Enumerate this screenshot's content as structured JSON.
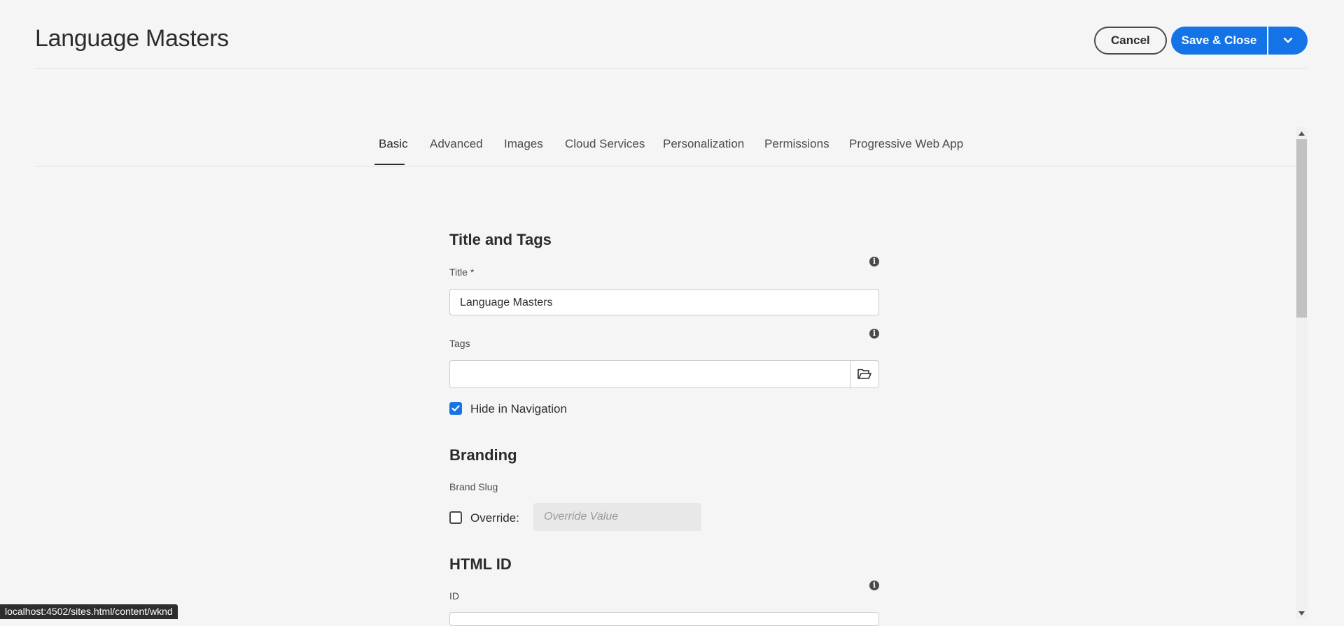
{
  "header": {
    "title": "Language Masters",
    "cancel_label": "Cancel",
    "save_label": "Save & Close"
  },
  "tabs": [
    {
      "label": "Basic",
      "active": true
    },
    {
      "label": "Advanced"
    },
    {
      "label": "Images"
    },
    {
      "label": "Cloud Services"
    },
    {
      "label": "Personalization"
    },
    {
      "label": "Permissions"
    },
    {
      "label": "Progressive Web App"
    }
  ],
  "form": {
    "title_and_tags": {
      "heading": "Title and Tags",
      "title_label": "Title *",
      "title_value": "Language Masters",
      "tags_label": "Tags",
      "tags_value": "",
      "hide_in_nav_label": "Hide in Navigation",
      "hide_in_nav_checked": true
    },
    "branding": {
      "heading": "Branding",
      "brand_slug_label": "Brand Slug",
      "override_label": "Override:",
      "override_checked": false,
      "override_placeholder": "Override Value"
    },
    "html_id": {
      "heading": "HTML ID",
      "id_label": "ID"
    }
  },
  "status_bar": {
    "url": "localhost:4502/sites.html/content/wknd"
  },
  "colors": {
    "accent": "#1473e6",
    "background": "#f5f5f5"
  },
  "icons": [
    "info-icon",
    "folder-icon",
    "chevron-down-icon",
    "checkmark-icon"
  ]
}
